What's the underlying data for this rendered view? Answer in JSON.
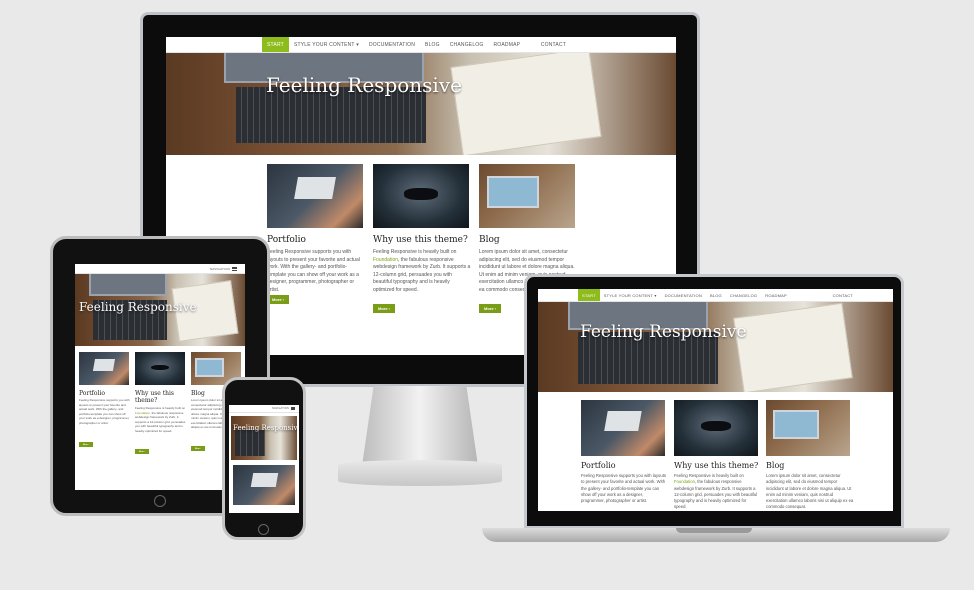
{
  "site": {
    "hero_title": "Feeling Responsive",
    "nav": {
      "start": "START",
      "style": "STYLE YOUR CONTENT",
      "style_caret": "▾",
      "documentation": "DOCUMENTATION",
      "blog": "BLOG",
      "changelog": "CHANGELOG",
      "roadmap": "ROADMAP",
      "contact": "CONTACT",
      "mobile_label": "NAVIGATION"
    },
    "columns": [
      {
        "title": "Portfolio",
        "text_pre": "Feeling Responsive supports you with layouts to present your favorite and actual work. With the gallery- and portfolio-template you can show off your work as a designer, programmer, photographer or artist.",
        "link": "",
        "text_post": "",
        "button": "More ›"
      },
      {
        "title": "Why use this theme?",
        "text_pre": "Feeling Responsive is heavily built on ",
        "link": "Foundation",
        "text_post": ", the fabulous responsive webdesign framework by Zurb. It supports a 12-column grid, persuades you with beautiful typography and is heavily optimized for speed.",
        "button": "More ›"
      },
      {
        "title": "Blog",
        "text_pre": "Lorem ipsum dolor sit amet, consectetur adipiscing elit, sed do eiusmod tempor incididunt ut labore et dolore magna aliqua. Ut enim ad minim veniam, quis nostrud exercitation ullamco laboris nisi ut aliquip ex ea commodo consequat.",
        "link": "",
        "text_post": "",
        "button": "More ›"
      }
    ]
  },
  "colors": {
    "accent": "#8fbc1d",
    "button": "#7a9d18",
    "background": "#e9e9e9"
  }
}
